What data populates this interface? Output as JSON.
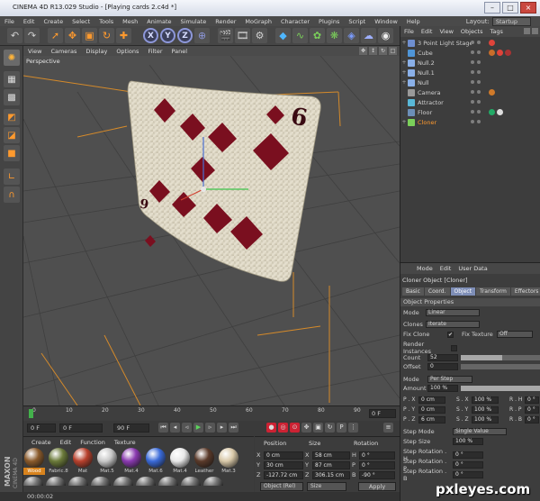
{
  "window": {
    "title": "CINEMA 4D R13.029 Studio - [Playing cards 2.c4d *]"
  },
  "menubar": {
    "items": [
      "File",
      "Edit",
      "Create",
      "Select",
      "Tools",
      "Mesh",
      "Animate",
      "Simulate",
      "Render",
      "MoGraph",
      "Character",
      "Plugins",
      "Script",
      "Window",
      "Help"
    ],
    "layout_label": "Layout:",
    "layout_value": "Startup"
  },
  "toolbar": {
    "x_label": "X",
    "y_label": "Y",
    "z_label": "Z"
  },
  "viewport": {
    "menu": [
      "View",
      "Cameras",
      "Display",
      "Options",
      "Filter",
      "Panel"
    ],
    "label": "Perspective"
  },
  "timeline": {
    "ticks": [
      "0",
      "10",
      "20",
      "30",
      "40",
      "50",
      "60",
      "70",
      "80",
      "90"
    ],
    "frame": "0 F"
  },
  "transport": {
    "start": "0 F",
    "current": "0 F",
    "end": "90 F"
  },
  "materials": {
    "menu": [
      "Create",
      "Edit",
      "Function",
      "Texture"
    ],
    "items": [
      {
        "label": "Wood",
        "color": "#8a5a2b",
        "selected": true
      },
      {
        "label": "Fabric.8",
        "color": "#6b7a3a",
        "selected": false
      },
      {
        "label": "Mat",
        "color": "#b8412d",
        "selected": false
      },
      {
        "label": "Mat.5",
        "color": "#c9c9c9",
        "selected": false
      },
      {
        "label": "Mat.4",
        "color": "#8a3ab0",
        "selected": false
      },
      {
        "label": "Mat.6",
        "color": "#3a6ad8",
        "selected": false
      },
      {
        "label": "Mat.4",
        "color": "#e8e8e8",
        "selected": false
      },
      {
        "label": "Leather",
        "color": "#5a3a2a",
        "selected": false
      },
      {
        "label": "Mat.3",
        "color": "#d8c8a8",
        "selected": false
      }
    ],
    "brand_top": "MAXON",
    "brand_bottom": "CINEMA 4D"
  },
  "coordinates": {
    "headers": [
      "Position",
      "Size",
      "Rotation"
    ],
    "rows": [
      {
        "axis": "X",
        "pos": "0 cm",
        "size_axis": "X",
        "size": "58 cm",
        "rot_axis": "H",
        "rot": "0 °"
      },
      {
        "axis": "Y",
        "pos": "30 cm",
        "size_axis": "Y",
        "size": "87 cm",
        "rot_axis": "P",
        "rot": "0 °"
      },
      {
        "axis": "Z",
        "pos": "-127.72 cm",
        "size_axis": "Z",
        "size": "306.15 cm",
        "rot_axis": "B",
        "rot": "-90 °"
      }
    ],
    "mode_left": "Object (Rel)",
    "mode_mid": "Size",
    "apply": "Apply"
  },
  "statusbar": {
    "time": "00:00:02"
  },
  "objects": {
    "menu": [
      "File",
      "Edit",
      "View",
      "Objects",
      "Tags"
    ],
    "items": [
      {
        "name": "3 Point Light Stage",
        "icon_color": "#6f8fd0",
        "tags": [
          "#e0443a"
        ],
        "selected": false,
        "expand": "+"
      },
      {
        "name": "Cube",
        "icon_color": "#4f95d8",
        "tags": [
          "#c96d2a",
          "#e0443a",
          "#a33"
        ],
        "selected": false,
        "expand": ""
      },
      {
        "name": "Null.2",
        "icon_color": "#8ab0e8",
        "tags": [],
        "selected": false,
        "expand": "+"
      },
      {
        "name": "Null.1",
        "icon_color": "#8ab0e8",
        "tags": [],
        "selected": false,
        "expand": "+"
      },
      {
        "name": "Null",
        "icon_color": "#8ab0e8",
        "tags": [],
        "selected": false,
        "expand": "+"
      },
      {
        "name": "Camera",
        "icon_color": "#9a9a9a",
        "tags": [
          "#d07a2a"
        ],
        "selected": false,
        "expand": ""
      },
      {
        "name": "Attractor",
        "icon_color": "#59b8d8",
        "tags": [],
        "selected": false,
        "expand": ""
      },
      {
        "name": "Floor",
        "icon_color": "#6c8fb8",
        "tags": [
          "#2a6",
          "#ddd"
        ],
        "selected": false,
        "expand": ""
      },
      {
        "name": "Cloner",
        "icon_color": "#7bd05a",
        "tags": [],
        "selected": true,
        "expand": "+"
      }
    ]
  },
  "attributes": {
    "menu": [
      "Mode",
      "Edit",
      "User Data"
    ],
    "title": "Cloner Object [Cloner]",
    "tabs": [
      "Basic",
      "Coord.",
      "Object",
      "Transform",
      "Effectors"
    ],
    "active_tab": "Object",
    "section": "Object Properties",
    "mode_label": "Mode",
    "mode_value": "Linear",
    "clones_label": "Clones",
    "clones_value": "Iterate",
    "fix_clone_label": "Fix Clone",
    "fix_clone_value": "✔",
    "fix_texture_label": "Fix Texture",
    "fix_texture_value": "Off",
    "render_instances_label": "Render Instances",
    "count_label": "Count",
    "count_value": "52",
    "count_fraction": 0.52,
    "offset_label": "Offset",
    "offset_value": "0",
    "mode2_label": "Mode",
    "mode2_value": "Per Step",
    "amount_label": "Amount",
    "amount_value": "100 %",
    "p_rows": [
      {
        "plabel": "P . X",
        "pval": "0 cm",
        "slabel": "S . X",
        "sval": "100 %",
        "rlabel": "R . H",
        "rval": "0 °"
      },
      {
        "plabel": "P . Y",
        "pval": "0 cm",
        "slabel": "S . Y",
        "sval": "100 %",
        "rlabel": "R . P",
        "rval": "0 °"
      },
      {
        "plabel": "P . Z",
        "pval": "6 cm",
        "slabel": "S . Z",
        "sval": "100 %",
        "rlabel": "R . B",
        "rval": "0 °"
      }
    ],
    "step_mode_label": "Step Mode",
    "step_mode_value": "Single Value",
    "step_size_label": "Step Size",
    "step_size_value": "100 %",
    "step_rot_h_label": "Step Rotation . H",
    "step_rot_h_value": "0 °",
    "step_rot_p_label": "Step Rotation . P",
    "step_rot_p_value": "0 °",
    "step_rot_b_label": "Step Rotation . B",
    "step_rot_b_value": "0 °"
  },
  "card": {
    "rank": "6"
  },
  "watermark": "pxleyes.com"
}
